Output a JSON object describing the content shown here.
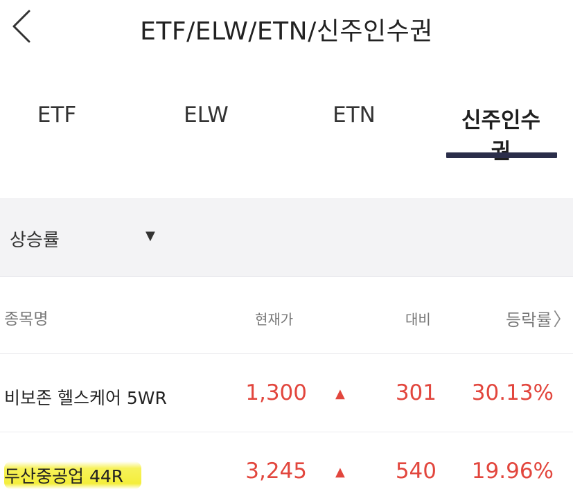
{
  "header": {
    "title": "ETF/ELW/ETN/신주인수권",
    "back_icon": "chevron-left-icon"
  },
  "tabs": [
    {
      "label": "ETF",
      "active": false
    },
    {
      "label": "ELW",
      "active": false
    },
    {
      "label": "ETN",
      "active": false
    },
    {
      "label": "신주인수권",
      "active": true
    }
  ],
  "filter": {
    "sort_label": "상승률",
    "caret": "▼"
  },
  "table": {
    "columns": [
      "종목명",
      "현재가",
      "대비",
      "등락률"
    ],
    "sort_chevron": "〉",
    "rows": [
      {
        "name": "비보존 헬스케어 5WR",
        "price": "1,300",
        "direction": "▲",
        "change": "301",
        "rate": "30.13%",
        "highlighted": false
      },
      {
        "name": "두산중공업 44R",
        "price": "3,245",
        "direction": "▲",
        "change": "540",
        "rate": "19.96%",
        "highlighted": true
      }
    ]
  },
  "colors": {
    "up": "#e2463d",
    "tab_indicator": "#2b2e4a",
    "filter_background": "#f3f3f5",
    "highlight": "#f4ee3c"
  }
}
